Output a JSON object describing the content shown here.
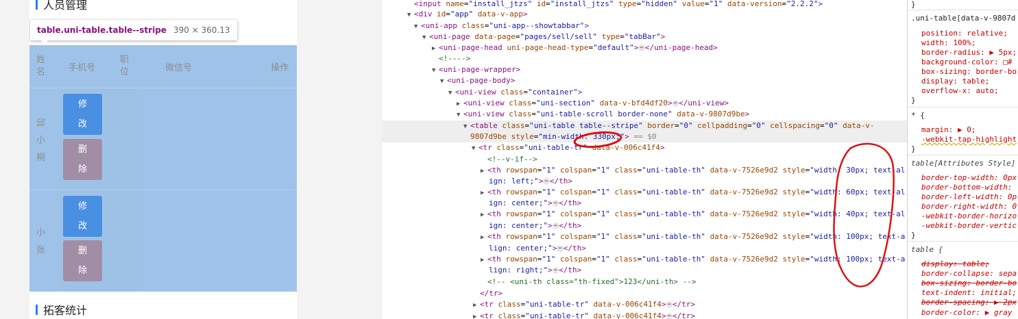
{
  "phone": {
    "section_title_1": "人员管理",
    "section_title_2": "拓客统计",
    "tooltip": {
      "selector": "table.uni-table.table--stripe",
      "dimensions": "390 × 360.13"
    },
    "table_headers": [
      {
        "label": "姓\n名",
        "lines": [
          "姓",
          "名"
        ]
      },
      {
        "label": "手机号",
        "lines": [
          "手机号"
        ]
      },
      {
        "label": "职\n位",
        "lines": [
          "职",
          "位"
        ]
      },
      {
        "label": "微信号",
        "lines": [
          "微信号"
        ]
      },
      {
        "label": "操作",
        "lines": [
          "操作"
        ]
      }
    ],
    "rows": [
      {
        "name": [
          "邱",
          "小",
          "桐"
        ],
        "edit": [
          "修",
          "改"
        ],
        "delete": [
          "删",
          "除"
        ]
      },
      {
        "name": [
          "小",
          "张"
        ],
        "edit": [
          "修",
          "改"
        ],
        "delete": [
          "删",
          "除"
        ]
      }
    ],
    "colors": {
      "accent": "#2979ff",
      "edit_button": "#4a90e2",
      "delete_button": "#a18ea6",
      "highlight": "#9fc3e8"
    }
  },
  "elements": {
    "lines": [
      "<input name=\"install_jtzs\" id=\"install_jtzs\" type=\"hidden\" value=\"1\" data-version=\"2.2.2\">",
      "<div id=\"app\" data-v-app>",
      "<uni-app class=\"uni-app--showtabbar\">",
      "<uni-page data-page=\"pages/sell/sell\" type=\"tabBar\">",
      "<uni-page-head uni-page-head-type=\"default\">⋯</uni-page-head>",
      "<!---->",
      "<uni-page-wrapper>",
      "<uni-page-body>",
      "<uni-view class=\"container\">",
      "<uni-view class=\"uni-section\" data-v-bfd4df20>⋯</uni-view>",
      "<uni-view class=\"uni-table-scroll border-none\" data-v-9807d9be>",
      "<table class=\"uni-table table--stripe\" border=\"0\" cellpadding=\"0\" cellspacing=\"0\" data-v-",
      "9807d9be style=\"min-width: 330px;\"> == $0",
      "<tr class=\"uni-table-tr\" data-v-006c41f4>",
      "<!--v-if-->",
      "<th rowspan=\"1\" colspan=\"1\" class=\"uni-table-th\" data-v-7526e9d2 style=\"width: 30px; text-al",
      "ign: left;\">⋯</th>",
      "<th rowspan=\"1\" colspan=\"1\" class=\"uni-table-th\" data-v-7526e9d2 style=\"width: 60px; text-al",
      "ign: center;\">⋯</th>",
      "<th rowspan=\"1\" colspan=\"1\" class=\"uni-table-th\" data-v-7526e9d2 style=\"width: 40px; text-al",
      "ign: center;\">⋯</th>",
      "<th rowspan=\"1\" colspan=\"1\" class=\"uni-table-th\" data-v-7526e9d2 style=\"width: 100px; text-a",
      "lign: center;\">⋯</th>",
      "<th rowspan=\"1\" colspan=\"1\" class=\"uni-table-th\" data-v-7526e9d2 style=\"width: 100px; text-a",
      "lign: right;\">⋯</th>",
      "<!-- <uni-th class=\"th-fixed\">123</uni-th> -->",
      "</tr>",
      "<tr class=\"uni-table-tr\" data-v-006c41f4>⋯</tr>",
      "<tr class=\"uni-table-tr\" data-v-006c41f4>⋯</tr>"
    ],
    "row_dots": "···"
  },
  "styles": {
    "lines": [
      "}",
      ".uni-table[data-v-9807d",
      "position: relative;",
      "width: 100%;",
      "border-radius: ▶ 5px;",
      "background-color: □#",
      "box-sizing: border-bo",
      "display: table;",
      "overflow-x: auto;",
      "}",
      "* {",
      "margin: ▶ 0;",
      "-webkit-tap-highlight",
      "}",
      "table[Attributes Style]",
      "border-top-width: 0px",
      "border-bottom-width:",
      "border-left-width: 0p",
      "border-right-width: 0",
      "-webkit-border-horizo",
      "-webkit-border-vertic",
      "}",
      "table {",
      "display: table;",
      "border-collapse: sepa",
      "box-sizing: border-bo",
      "text-indent: initial;",
      "border-spacing: ▶ 2px",
      "border-color: ▶ gray"
    ]
  }
}
